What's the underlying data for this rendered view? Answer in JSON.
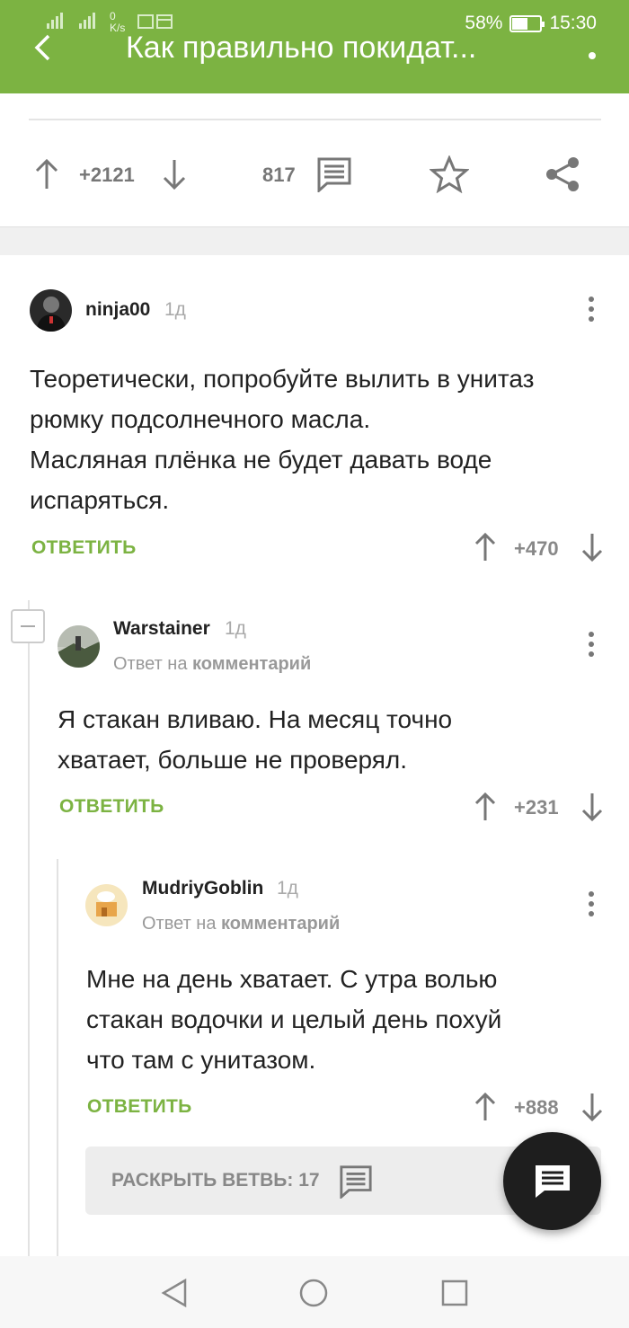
{
  "status_bar": {
    "signal_left": "4G",
    "speed": "0\nK/s",
    "battery_percent": "58%",
    "battery_level": 0.58,
    "time": "15:30"
  },
  "app_bar": {
    "title": "Как правильно покидат...",
    "accent": "#7cb342"
  },
  "post": {
    "votes": "+2121",
    "comments_count": "817"
  },
  "comments": [
    {
      "author": "ninja00",
      "age": "1д",
      "lines": [
        "Теоретически, попробуйте вылить в унитаз",
        "рюмку подсолнечного масла.",
        "Масляная плёнка не будет давать воде",
        "испаряться."
      ],
      "reply_label": "ОТВЕТИТЬ",
      "score": "+470"
    },
    {
      "author": "Warstainer",
      "age": "1д",
      "reply_to_prefix": "Ответ на",
      "reply_to_target": "комментарий",
      "lines": [
        "Я стакан вливаю. На месяц точно",
        "хватает, больше не проверял."
      ],
      "reply_label": "ОТВЕТИТЬ",
      "score": "+231"
    },
    {
      "author": "MudriyGoblin",
      "age": "1д",
      "reply_to_prefix": "Ответ на",
      "reply_to_target": "комментарий",
      "lines": [
        "Мне на день хватает. С утра волью",
        "стакан водочки и целый день похуй",
        "что там с унитазом."
      ],
      "reply_label": "ОТВЕТИТЬ",
      "score": "+888"
    }
  ],
  "expand_thread": {
    "label": "РАСКРЫТЬ ВЕТВЬ: 17"
  },
  "icons": [
    "back-arrow-icon",
    "more-vert-icon",
    "arrow-up-icon",
    "arrow-down-icon",
    "comment-icon",
    "star-icon",
    "share-icon",
    "nav-back-icon",
    "nav-home-icon",
    "nav-recents-icon"
  ]
}
